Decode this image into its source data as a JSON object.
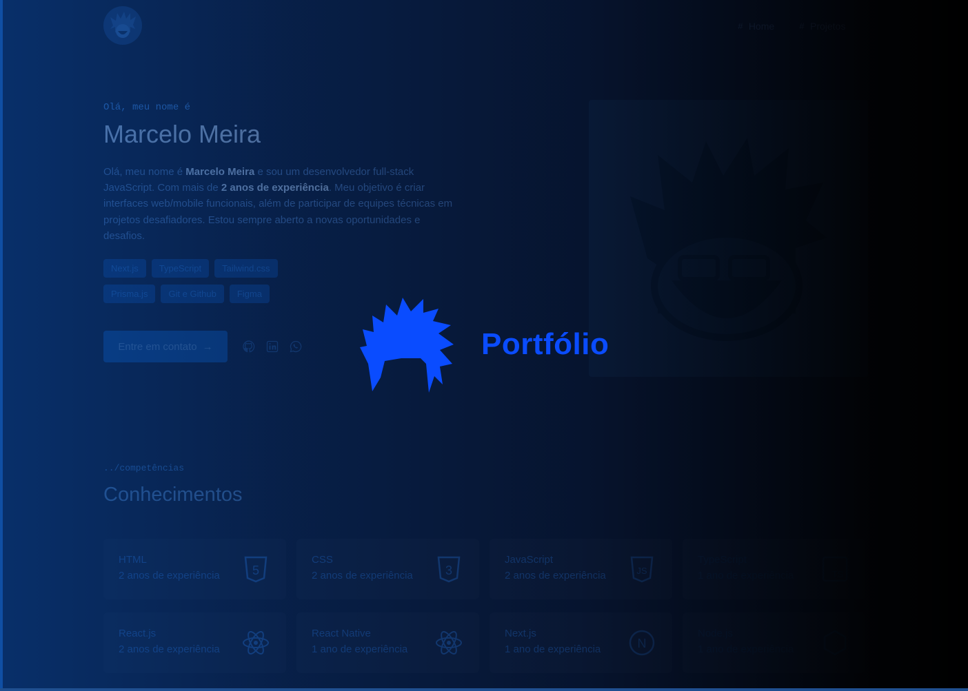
{
  "header": {
    "nav": [
      {
        "number": "#",
        "label": "Home"
      },
      {
        "number": "#",
        "label": "Projetos"
      }
    ]
  },
  "hero": {
    "kicker": "Olá, meu nome é",
    "name": "Marcelo Meira",
    "description": {
      "p1": "Olá, meu nome é ",
      "b1": "Marcelo Meira",
      "p2": " e sou um desenvolvedor full-stack JavaScript. Com mais de ",
      "b2": "2 anos de experiência",
      "p3": ". Meu objetivo é criar interfaces web/mobile funcionais, além de participar de equipes técnicas em projetos desafiadores. Estou sempre aberto a novas oportunidades e desafios."
    },
    "tags": [
      "Next.js",
      "TypeScript",
      "Tailwind.css",
      "Prisma.js",
      "Git e Github",
      "Figma"
    ],
    "cta_label": "Entre em contato",
    "cta_arrow": "→",
    "socials": [
      "github-icon",
      "linkedin-icon",
      "whatsapp-icon"
    ]
  },
  "competencies": {
    "kicker": "../competências",
    "title": "Conhecimentos",
    "skills": [
      {
        "name": "HTML",
        "experience": "2 anos de experiência",
        "icon": "html5-icon",
        "icon_text": "5"
      },
      {
        "name": "CSS",
        "experience": "2 anos de experiência",
        "icon": "css3-icon",
        "icon_text": "3"
      },
      {
        "name": "JavaScript",
        "experience": "2 anos de experiência",
        "icon": "javascript-icon",
        "icon_text": "JS"
      },
      {
        "name": "TypeScript",
        "experience": "1 ano de experiência",
        "icon": "typescript-icon",
        "icon_text": "TS"
      },
      {
        "name": "React.js",
        "experience": "2 anos de experiência",
        "icon": "react-icon",
        "icon_text": ""
      },
      {
        "name": "React Native",
        "experience": "1 ano de experiência",
        "icon": "react-native-icon",
        "icon_text": ""
      },
      {
        "name": "Next.js",
        "experience": "1 ano de experiência",
        "icon": "nextjs-icon",
        "icon_text": "N"
      },
      {
        "name": "Node.js",
        "experience": "1 ano de experiência",
        "icon": "nodejs-icon",
        "icon_text": ""
      }
    ]
  },
  "splash": {
    "title": "Portfólio",
    "icon": "spiky-hair-logo-icon",
    "color": "#0a4cff"
  },
  "colors": {
    "accent": "#0a4cff",
    "background": "#0b1428"
  }
}
